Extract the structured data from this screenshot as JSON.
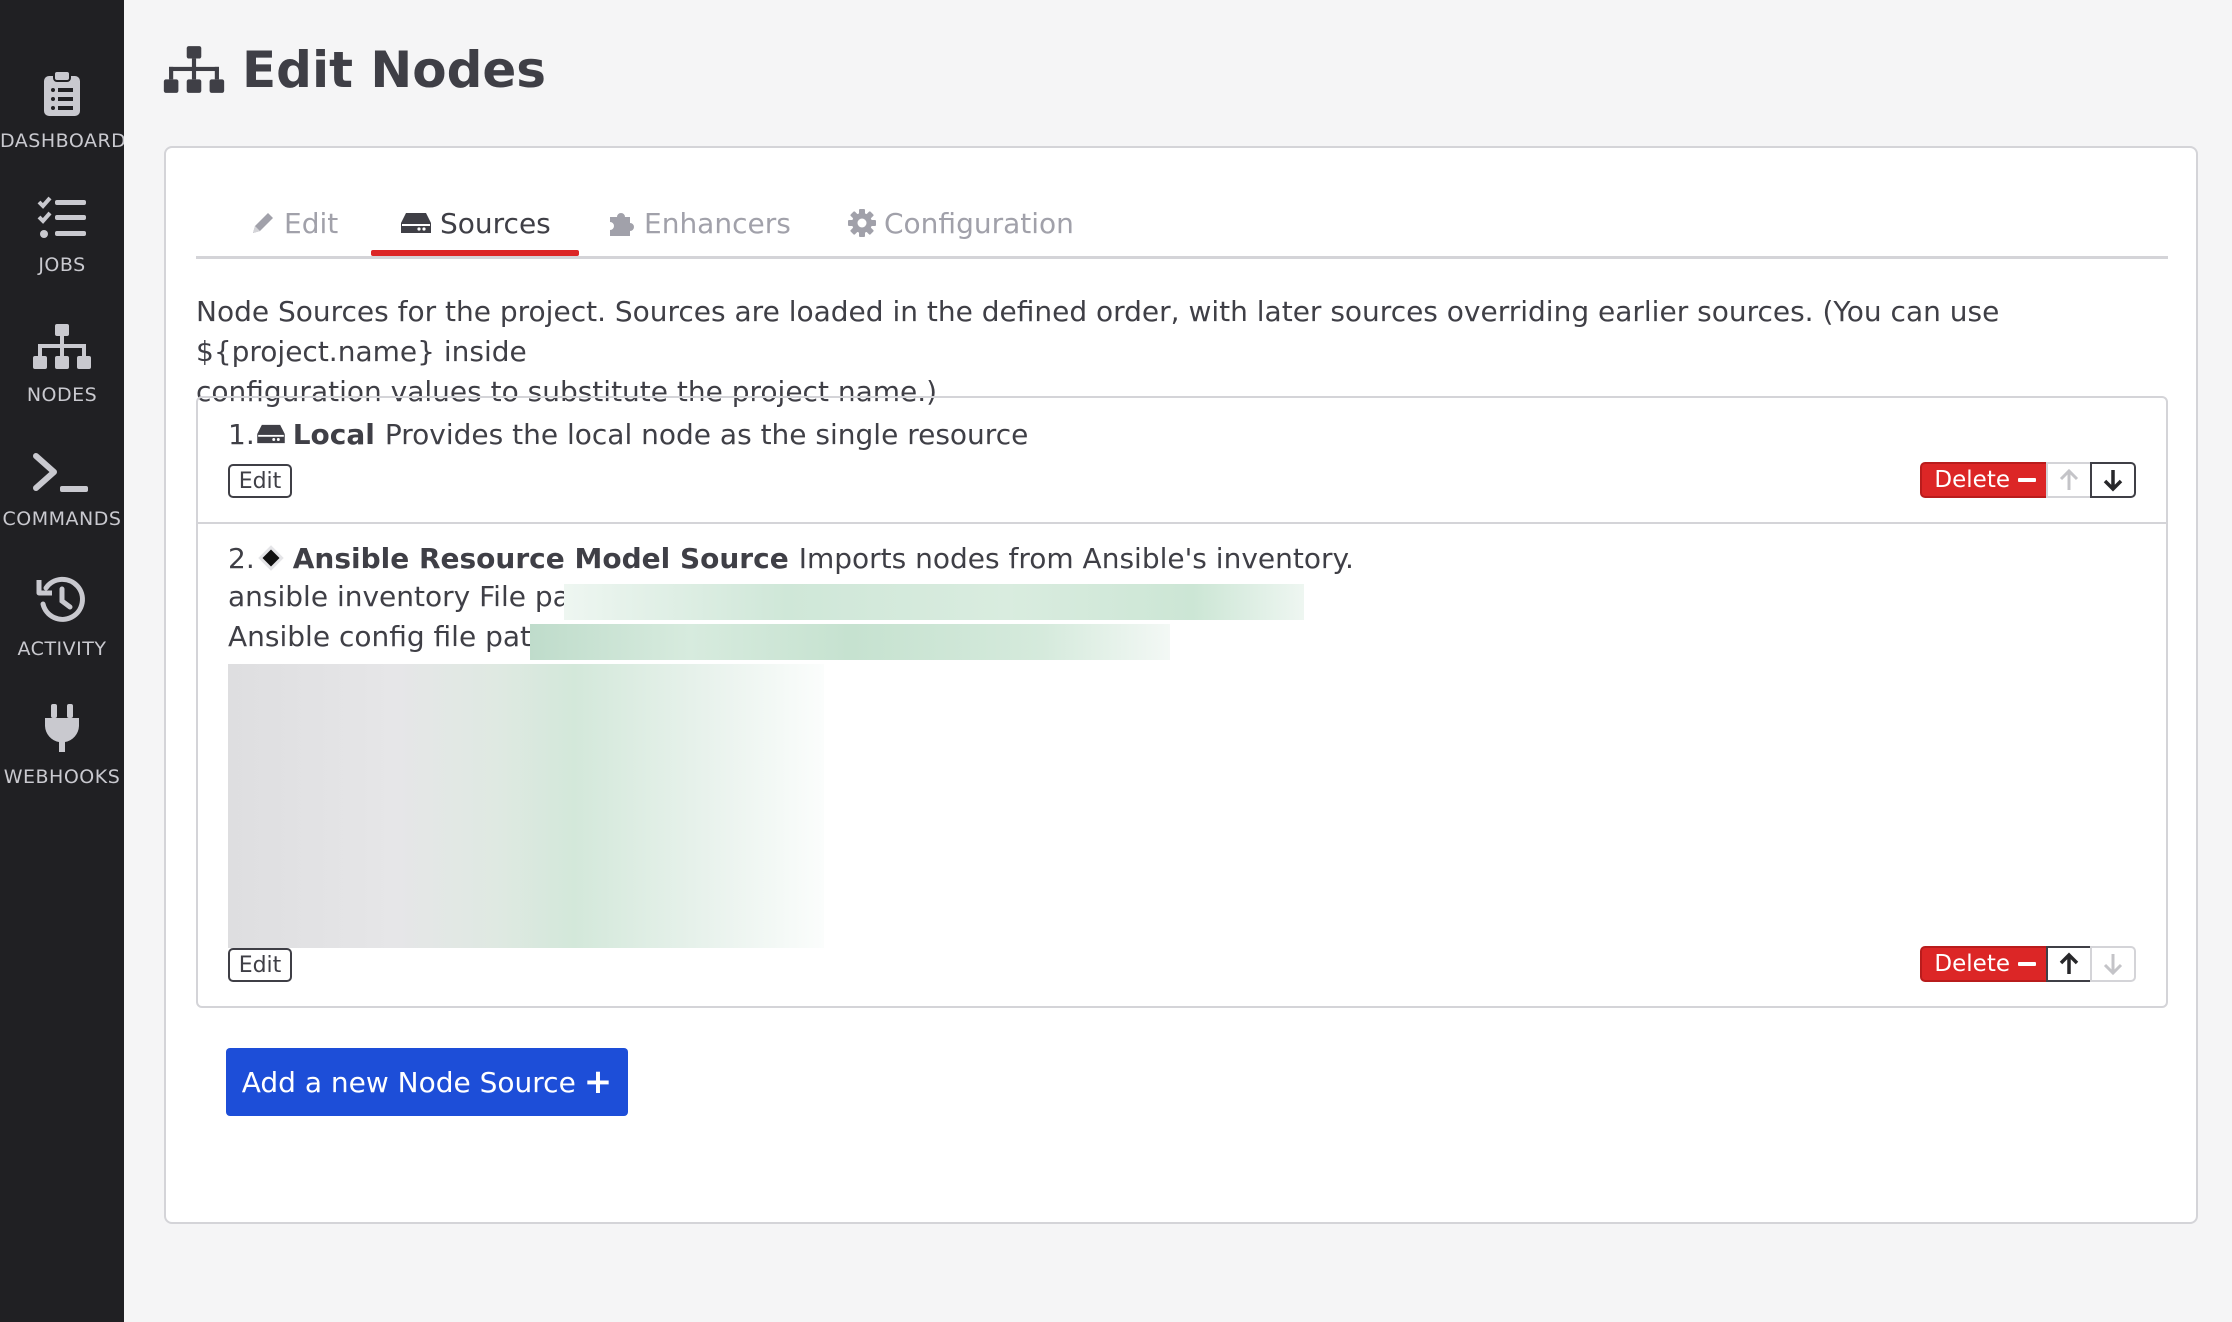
{
  "sidebar": {
    "items": [
      {
        "label": "DASHBOARD",
        "icon": "clipboard-icon"
      },
      {
        "label": "JOBS",
        "icon": "list-icon"
      },
      {
        "label": "NODES",
        "icon": "sitemap-icon"
      },
      {
        "label": "COMMANDS",
        "icon": "terminal-icon"
      },
      {
        "label": "ACTIVITY",
        "icon": "history-icon"
      },
      {
        "label": "WEBHOOKS",
        "icon": "plug-icon"
      }
    ]
  },
  "header": {
    "title": "Edit Nodes",
    "icon": "sitemap-icon"
  },
  "tabs": [
    {
      "label": "Edit",
      "icon": "pencil-icon",
      "active": false
    },
    {
      "label": "Sources",
      "icon": "hdd-icon",
      "active": true
    },
    {
      "label": "Enhancers",
      "icon": "puzzle-icon",
      "active": false
    },
    {
      "label": "Configuration",
      "icon": "gear-icon",
      "active": false
    }
  ],
  "intro": {
    "line1": "Node Sources for the project. Sources are loaded in the defined order, with later sources overriding earlier sources. (You can use ${project.name} inside",
    "line2": "configuration values to substitute the project name.)"
  },
  "sources": [
    {
      "index": "1.",
      "icon": "hdd-icon",
      "name": "Local",
      "description": "Provides the local node as the single resource",
      "edit_label": "Edit",
      "delete_label": "Delete",
      "move_up_enabled": false,
      "move_down_enabled": true
    },
    {
      "index": "2.",
      "icon": "diamond-icon",
      "name": "Ansible Resource Model Source",
      "description": "Imports nodes from Ansible's inventory.",
      "inventory_label": "ansible inventory File path",
      "config_label": "Ansible config file path:",
      "edit_label": "Edit",
      "delete_label": "Delete",
      "move_up_enabled": true,
      "move_down_enabled": false
    }
  ],
  "add_button": {
    "label": "Add a new Node Source",
    "icon": "plus-icon"
  },
  "colors": {
    "sidebar_bg": "#202023",
    "accent_red": "#dc2626",
    "primary_blue": "#1d4ed8",
    "page_bg": "#f5f5f6"
  }
}
